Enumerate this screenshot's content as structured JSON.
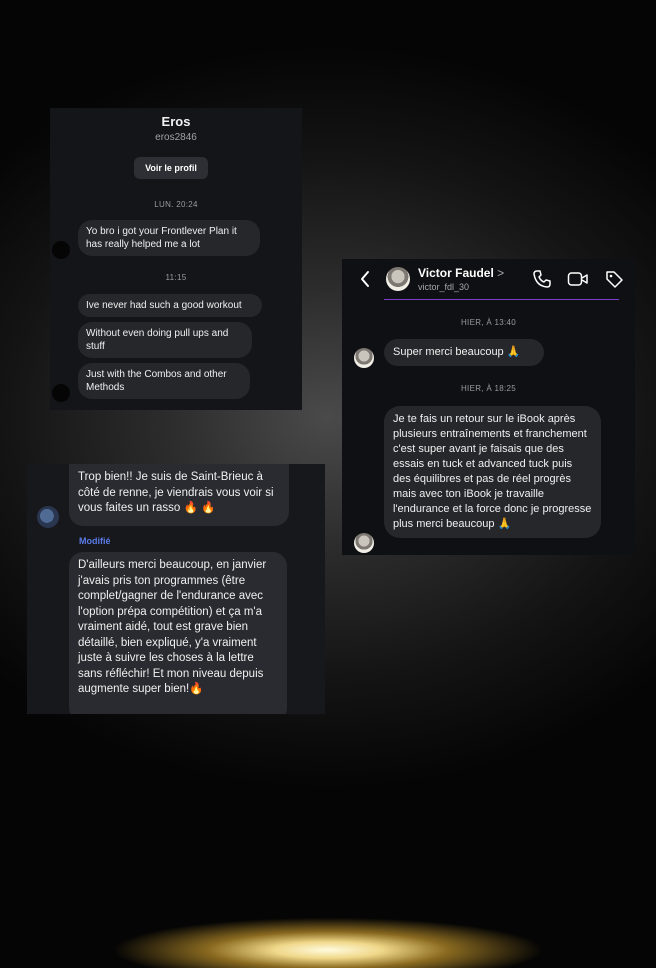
{
  "conversation1": {
    "name": "Eros",
    "handle": "eros2846",
    "profile_button": "Voir le profil",
    "timestamp1": "LUN. 20:24",
    "msg1": "Yo bro i got your Frontlever Plan it has really helped me a lot",
    "timestamp2": "11:15",
    "msg2": "Ive never had such a good workout",
    "msg3": "Without even doing pull ups and stuff",
    "msg4": "Just with the Combos and other Methods"
  },
  "conversation2": {
    "name": "Victor Faudel",
    "name_chevron": ">",
    "handle": "victor_fdl_30",
    "timestamp1": "HIER, À 13:40",
    "msg1": "Super merci beaucoup 🙏",
    "timestamp2": "HIER, À 18:25",
    "msg2": "Je te fais un retour sur le iBook après plusieurs entraînements et franchement c'est super avant je faisais que des essais en tuck et advanced tuck puis des équilibres et pas de réel progrès mais avec ton iBook je travaille l'endurance et la force donc je progresse plus merci beaucoup 🙏"
  },
  "conversation3": {
    "msg1": "Trop bien!! Je suis de Saint-Brieuc à côté de renne, je viendrais vous voir si vous faites un rasso 🔥 🔥",
    "modified_label": "Modifié",
    "msg2": "D'ailleurs merci beaucoup, en janvier j'avais pris ton programmes (être complet/gagner de l'endurance avec l'option prépa compétition) et ça m'a vraiment aidé, tout est grave bien détaillé, bien expliqué, y'a vraiment juste à suivre les choses à la lettre sans réfléchir! Et mon niveau depuis augmente super bien!🔥"
  },
  "icons": [
    "back-arrow-icon",
    "phone-icon",
    "video-camera-icon",
    "tag-icon"
  ],
  "colors": {
    "accent_underline": "#7b3fc7",
    "modified_label": "#5b7be8",
    "bubble": "#26272b"
  }
}
